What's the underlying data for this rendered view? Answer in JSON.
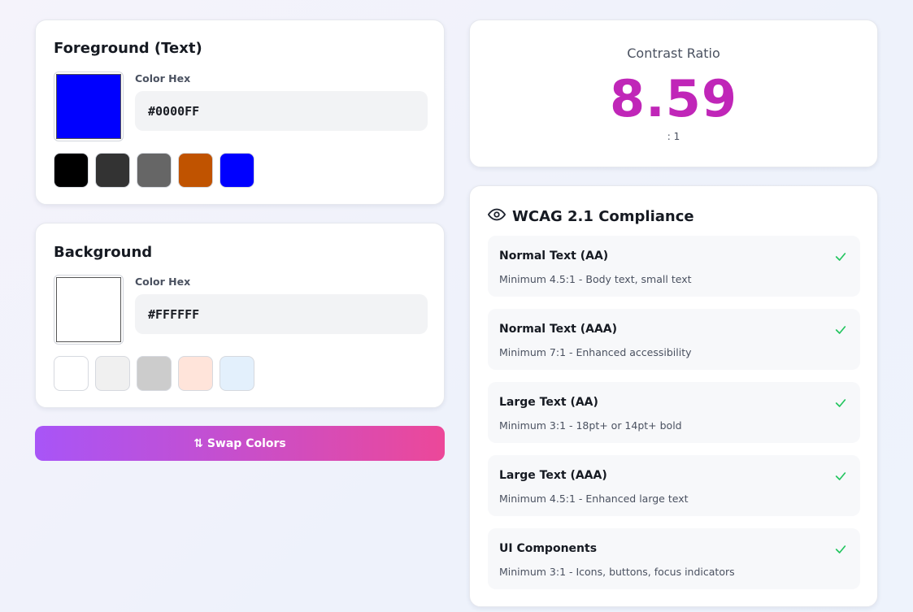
{
  "foreground": {
    "title": "Foreground (Text)",
    "hex_label": "Color Hex",
    "hex_value": "#0000FF",
    "color": "#0000FF",
    "presets": [
      "#000000",
      "#333333",
      "#666666",
      "#C05300",
      "#0000FF"
    ]
  },
  "background": {
    "title": "Background",
    "hex_label": "Color Hex",
    "hex_value": "#FFFFFF",
    "color": "#FFFFFF",
    "presets": [
      "#FFFFFF",
      "#F0F0F0",
      "#CCCCCC",
      "#FFE4DA",
      "#E3F0FC"
    ]
  },
  "swap_label": "⇅ Swap Colors",
  "contrast": {
    "label": "Contrast Ratio",
    "value": "8.59",
    "suffix": ": 1",
    "color": "#C026B8"
  },
  "wcag": {
    "icon": "eye-icon",
    "title": "WCAG 2.1 Compliance",
    "pass_color": "#22C55E",
    "checks": [
      {
        "name": "Normal Text (AA)",
        "desc": "Minimum 4.5:1 - Body text, small text",
        "pass": true
      },
      {
        "name": "Normal Text (AAA)",
        "desc": "Minimum 7:1 - Enhanced accessibility",
        "pass": true
      },
      {
        "name": "Large Text (AA)",
        "desc": "Minimum 3:1 - 18pt+ or 14pt+ bold",
        "pass": true
      },
      {
        "name": "Large Text (AAA)",
        "desc": "Minimum 4.5:1 - Enhanced large text",
        "pass": true
      },
      {
        "name": "UI Components",
        "desc": "Minimum 3:1 - Icons, buttons, focus indicators",
        "pass": true
      }
    ]
  }
}
